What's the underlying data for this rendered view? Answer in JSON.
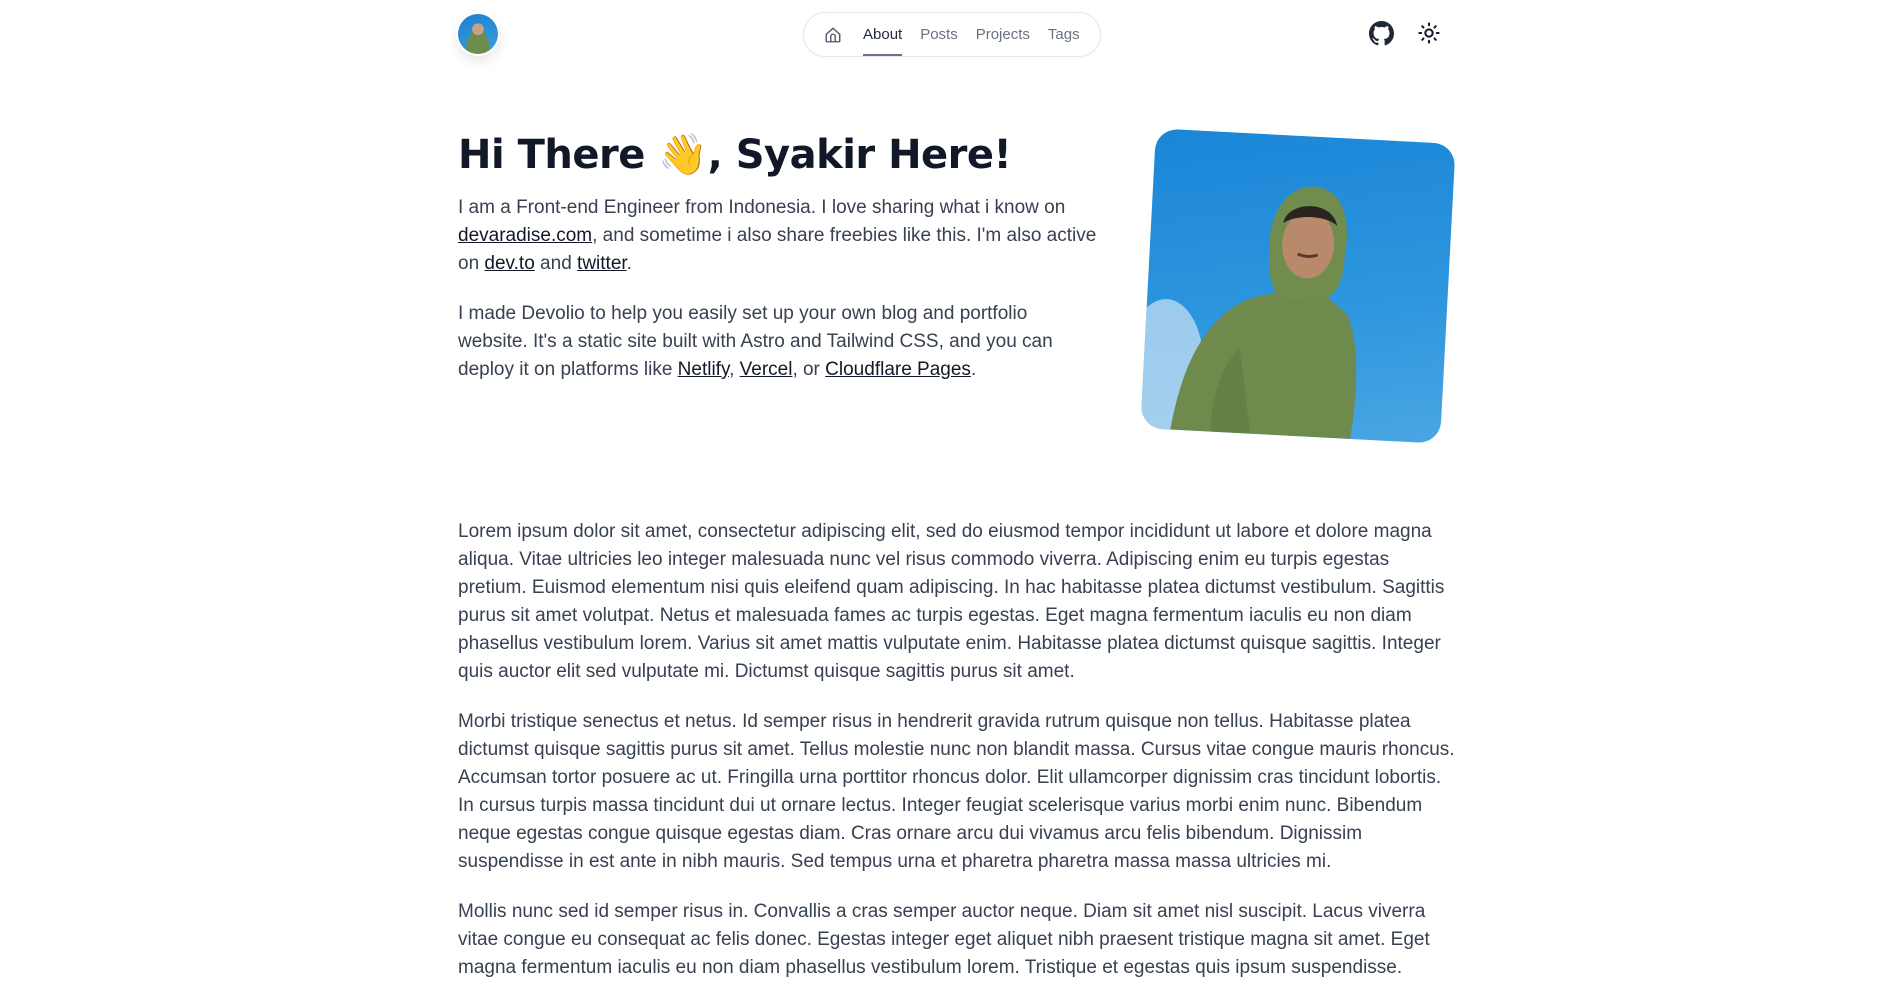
{
  "header": {
    "avatar_alt": "Syakir avatar",
    "nav": {
      "home_icon": "home-icon",
      "items": [
        {
          "label": "About",
          "active": true
        },
        {
          "label": "Posts",
          "active": false
        },
        {
          "label": "Projects",
          "active": false
        },
        {
          "label": "Tags",
          "active": false
        }
      ]
    },
    "icons": [
      "github-icon",
      "sun-icon"
    ]
  },
  "hero": {
    "title_pre": "Hi There ",
    "title_emoji": "👋",
    "title_post": ", Syakir Here!",
    "p1": {
      "t1": "I am a Front-end Engineer from Indonesia. I love sharing what i know on ",
      "link1": "devaradise.com",
      "t2": ", and sometime i also share freebies like this. I'm also active on ",
      "link2": "dev.to",
      "t3": " and ",
      "link3": "twitter",
      "t4": "."
    },
    "p2": {
      "t1": "I made Devolio to help you easily set up your own blog and portfolio website. It's a static site built with Astro and Tailwind CSS, and you can deploy it on platforms like ",
      "link1": "Netlify",
      "t2": ", ",
      "link2": "Vercel",
      "t3": ", or ",
      "link3": "Cloudflare Pages",
      "t4": "."
    },
    "photo_alt": "Photo of Syakir in a green hoodie against blue sky"
  },
  "body": {
    "paragraphs": [
      "Lorem ipsum dolor sit amet, consectetur adipiscing elit, sed do eiusmod tempor incididunt ut labore et dolore magna aliqua. Vitae ultricies leo integer malesuada nunc vel risus commodo viverra. Adipiscing enim eu turpis egestas pretium. Euismod elementum nisi quis eleifend quam adipiscing. In hac habitasse platea dictumst vestibulum. Sagittis purus sit amet volutpat. Netus et malesuada fames ac turpis egestas. Eget magna fermentum iaculis eu non diam phasellus vestibulum lorem. Varius sit amet mattis vulputate enim. Habitasse platea dictumst quisque sagittis. Integer quis auctor elit sed vulputate mi. Dictumst quisque sagittis purus sit amet.",
      "Morbi tristique senectus et netus. Id semper risus in hendrerit gravida rutrum quisque non tellus. Habitasse platea dictumst quisque sagittis purus sit amet. Tellus molestie nunc non blandit massa. Cursus vitae congue mauris rhoncus. Accumsan tortor posuere ac ut. Fringilla urna porttitor rhoncus dolor. Elit ullamcorper dignissim cras tincidunt lobortis. In cursus turpis massa tincidunt dui ut ornare lectus. Integer feugiat scelerisque varius morbi enim nunc. Bibendum neque egestas congue quisque egestas diam. Cras ornare arcu dui vivamus arcu felis bibendum. Dignissim suspendisse in est ante in nibh mauris. Sed tempus urna et pharetra pharetra massa massa ultricies mi.",
      "Mollis nunc sed id semper risus in. Convallis a cras semper auctor neque. Diam sit amet nisl suscipit. Lacus viverra vitae congue eu consequat ac felis donec. Egestas integer eget aliquet nibh praesent tristique magna sit amet. Eget magna fermentum iaculis eu non diam phasellus vestibulum lorem. Tristique et egestas quis ipsum suspendisse."
    ]
  },
  "colors": {
    "heading": "#111827",
    "text": "#374151",
    "nav_inactive": "#6b7280",
    "nav_active": "#1f2937",
    "border": "#e5e7eb"
  }
}
